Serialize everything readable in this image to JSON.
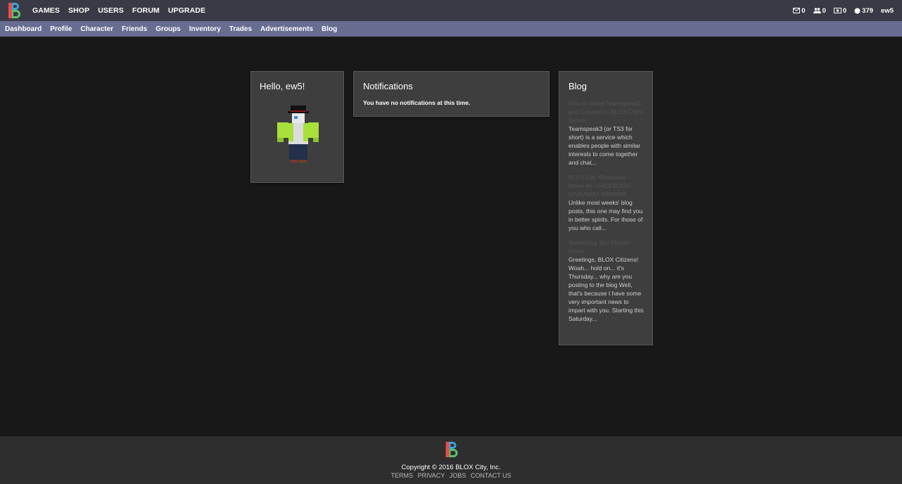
{
  "header": {
    "brand": "B",
    "nav": [
      "GAMES",
      "SHOP",
      "USERS",
      "FORUM",
      "UPGRADE"
    ],
    "stats": {
      "messages": "0",
      "friend_requests": "0",
      "trades": "0",
      "currency": "379"
    },
    "username": "ew5"
  },
  "subnav": [
    "Dashboard",
    "Profile",
    "Character",
    "Friends",
    "Groups",
    "Inventory",
    "Trades",
    "Advertisements",
    "Blog"
  ],
  "hello": {
    "title": "Hello, ew5!"
  },
  "notifications": {
    "title": "Notifications",
    "empty_text": "You have no notifications at this time."
  },
  "blog": {
    "title": "Blog",
    "posts": [
      {
        "title": "How to Install Teamspeak3 and Connect to BLOX City's Server",
        "excerpt": "Teamspeak3 (or TS3 for short) is a service which enables people with similar interests to come together and chat..."
      },
      {
        "title": "BLOX City Showcase - Week #4 - FACEBOOK GIVEAWAY WINNER!",
        "excerpt": "Unlike most weeks' blog posts, this one may find you in better spirits. For those of you who call..."
      },
      {
        "title": "Something You Should Know...",
        "excerpt": "Greetings, BLOX Citizens! Woah... hold on... it's Thursday... why are you posting to the blog Well, that's because I have some very important news to impart with you. Starting this Saturday..."
      }
    ]
  },
  "footer": {
    "copyright": "Copyright © 2016 BLOX City, Inc.",
    "links": [
      "TERMS",
      "PRIVACY",
      "JOBS",
      "CONTACT US"
    ]
  },
  "icons": {
    "messages": "envelope-icon",
    "friend_requests": "users-icon",
    "trades": "money-icon",
    "currency": "coin-icon"
  }
}
